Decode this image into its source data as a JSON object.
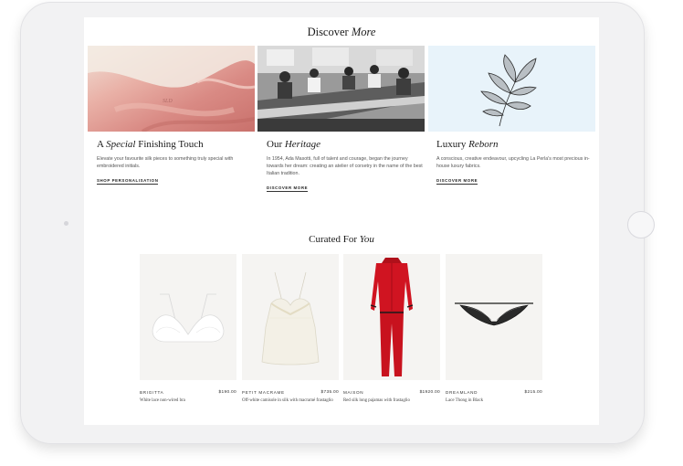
{
  "discover": {
    "title_main": "Discover ",
    "title_em": "More",
    "cards": [
      {
        "title_pre": "A ",
        "title_em": "Special",
        "title_post": " Finishing Touch",
        "description": "Elevate your favourite silk pieces to something truly special with embroidered initials.",
        "link": "SHOP PERSONALISATION"
      },
      {
        "title_pre": "Our ",
        "title_em": "Heritage",
        "title_post": "",
        "description": "In 1954, Ada Masotti, full of talent and courage, began the journey towards her dream: creating an atelier of corsetry in the name of the best Italian tradition.",
        "link": "DISCOVER MORE"
      },
      {
        "title_pre": "Luxury ",
        "title_em": "Reborn",
        "title_post": "",
        "description": "A conscious, creative endeavour, upcycling La Perla's most precious in-house luxury fabrics.",
        "link": "DISCOVER MORE"
      }
    ]
  },
  "curated": {
    "title_main": "Curated For ",
    "title_em": "You",
    "products": [
      {
        "brand": "BRIGITTA",
        "price": "$190.00",
        "description": "White lace non-wired bra"
      },
      {
        "brand": "PETIT MACRAME",
        "price": "$735.00",
        "description": "Off-white camisole in silk with macramé frastaglio"
      },
      {
        "brand": "MAISON",
        "price": "$1920.00",
        "description": "Red silk long pajamas with frastaglio"
      },
      {
        "brand": "DREAMLAND",
        "price": "$215.00",
        "description": "Lace Thong in Black"
      }
    ]
  }
}
